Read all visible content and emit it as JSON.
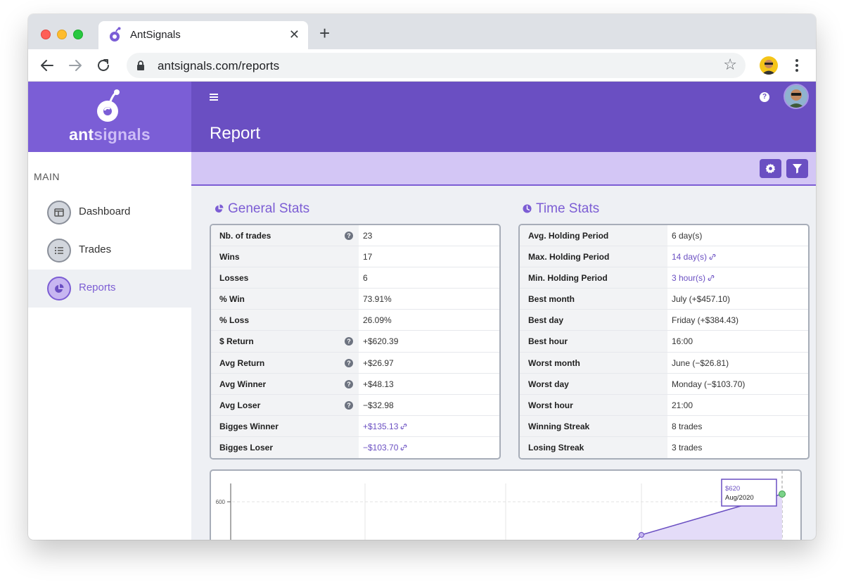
{
  "browser": {
    "tab_title": "AntSignals",
    "tab_close": "✕",
    "new_tab": "+",
    "url": "antsignals.com/reports",
    "star": "☆"
  },
  "brand": {
    "name_part1": "ant",
    "name_part2": "signals"
  },
  "header": {
    "title": "Report",
    "help": "?"
  },
  "sidebar": {
    "section": "MAIN",
    "items": [
      {
        "label": "Dashboard",
        "icon": "dashboard-icon",
        "active": false
      },
      {
        "label": "Trades",
        "icon": "list-icon",
        "active": false
      },
      {
        "label": "Reports",
        "icon": "pie-chart-icon",
        "active": true
      }
    ]
  },
  "general_stats": {
    "title": "General Stats",
    "rows": [
      {
        "label": "Nb. of trades",
        "value": "23",
        "help": true,
        "link": false
      },
      {
        "label": "Wins",
        "value": "17",
        "help": false,
        "link": false
      },
      {
        "label": "Losses",
        "value": "6",
        "help": false,
        "link": false
      },
      {
        "label": "% Win",
        "value": "73.91%",
        "help": false,
        "link": false
      },
      {
        "label": "% Loss",
        "value": "26.09%",
        "help": false,
        "link": false
      },
      {
        "label": "$ Return",
        "value": "+$620.39",
        "help": true,
        "link": false
      },
      {
        "label": "Avg Return",
        "value": "+$26.97",
        "help": true,
        "link": false
      },
      {
        "label": "Avg Winner",
        "value": "+$48.13",
        "help": true,
        "link": false
      },
      {
        "label": "Avg Loser",
        "value": "−$32.98",
        "help": true,
        "link": false
      },
      {
        "label": "Bigges Winner",
        "value": "+$135.13",
        "help": false,
        "link": true
      },
      {
        "label": "Bigges Loser",
        "value": "−$103.70",
        "help": false,
        "link": true
      }
    ]
  },
  "time_stats": {
    "title": "Time Stats",
    "rows": [
      {
        "label": "Avg. Holding Period",
        "value": "6 day(s)",
        "link": false
      },
      {
        "label": "Max. Holding Period",
        "value": "14 day(s)",
        "link": true
      },
      {
        "label": "Min. Holding Period",
        "value": "3 hour(s)",
        "link": true
      },
      {
        "label": "Best month",
        "value": "July (+$457.10)",
        "link": false
      },
      {
        "label": "Best day",
        "value": "Friday (+$384.43)",
        "link": false
      },
      {
        "label": "Best hour",
        "value": "16:00",
        "link": false
      },
      {
        "label": "Worst month",
        "value": "June (−$26.81)",
        "link": false
      },
      {
        "label": "Worst day",
        "value": "Monday (−$103.70)",
        "link": false
      },
      {
        "label": "Worst hour",
        "value": "21:00",
        "link": false
      },
      {
        "label": "Winning Streak",
        "value": "8 trades",
        "link": false
      },
      {
        "label": "Losing Streak",
        "value": "3 trades",
        "link": false
      }
    ]
  },
  "chart": {
    "y_tick": "600",
    "tooltip_value": "$620",
    "tooltip_label": "Aug/2020"
  },
  "colors": {
    "primary": "#6a4fc2",
    "brand": "#7b5ed6",
    "subbar": "#d3c6f5",
    "accent_text": "#7c5dd4",
    "point": "#7cd38a"
  }
}
